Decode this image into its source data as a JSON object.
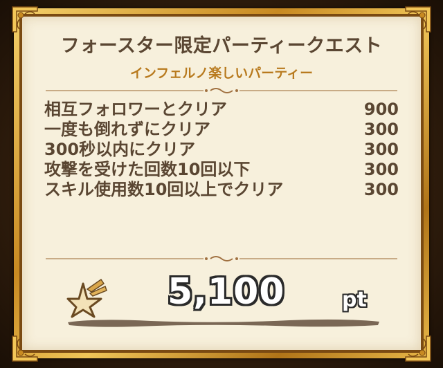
{
  "quest": {
    "title": "フォースター限定パーティークエスト",
    "subtitle": "インフェルノ楽しいパーティー"
  },
  "bonuses": [
    {
      "label": "相互フォロワーとクリア",
      "value": "900"
    },
    {
      "label": "一度も倒れずにクリア",
      "value": "300"
    },
    {
      "label": "300秒以内にクリア",
      "value": "300"
    },
    {
      "label": "攻撃を受けた回数10回以下",
      "value": "300"
    },
    {
      "label": "スキル使用数10回以上でクリア",
      "value": "300"
    }
  ],
  "total": {
    "icon": "shooting-star-icon",
    "value": "5,100",
    "unit": "pt"
  },
  "colors": {
    "frame_gold": "#d9a232",
    "panel": "#f7f0dc",
    "text": "#5a4632",
    "subtitle": "#b87a1e"
  }
}
